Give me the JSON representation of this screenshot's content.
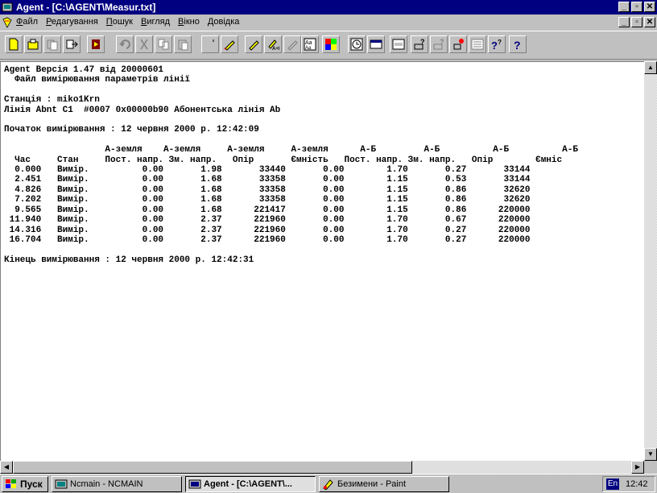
{
  "window": {
    "title": "Agent - [C:\\AGENT\\Measur.txt]",
    "controls": [
      "_",
      "▫",
      "✕"
    ]
  },
  "menu": {
    "items": [
      {
        "accel": "Ф",
        "rest": "айл"
      },
      {
        "accel": "Р",
        "rest": "едагування"
      },
      {
        "accel": "П",
        "rest": "ошук"
      },
      {
        "accel": "В",
        "rest": "игляд"
      },
      {
        "accel": "В",
        "rest": "ікно"
      },
      {
        "accel": "Д",
        "rest": "овідка"
      }
    ],
    "doc_controls": [
      "_",
      "▫",
      "✕"
    ]
  },
  "toolbar": {
    "icons": [
      "new-file-icon",
      "open-file-icon",
      "copy-file-icon",
      "export-file-icon",
      "exit-icon",
      "undo-icon",
      "cut-icon",
      "copy-icon",
      "paste-icon",
      "clear-icon",
      "edit-icon",
      "find-icon",
      "replace-icon",
      "find-next-icon",
      "font-icon",
      "colors-icon",
      "clock-icon",
      "window-icon",
      "status-icon",
      "help-topic-icon",
      "help-context-icon",
      "help-search-icon",
      "help-index-icon",
      "about-icon",
      "help-icon"
    ]
  },
  "document": {
    "text": "Agent Версія 1.47 від 20000601\n  Файл вимірювання параметрів лінії\n\nСтанція : miko1Krn\nЛінія Abnt C1  #0007 0x00000b90 Абонентська лінія Ab\n\nПочаток вимірювання : 12 червня 2000 р. 12:42:09\n\n                   А-земля    А-земля     А-земля     А-земля      А-Б         А-Б          А-Б          А-Б\n  Час     Стан     Пост. напр. Зм. напр.   Опір       Ємність   Пост. напр. Зм. напр.   Опір        Ємніс\n  0.000   Вимір.          0.00       1.98       33440       0.00        1.70       0.27       33144\n  2.451   Вимір.          0.00       1.68       33358       0.00        1.15       0.53       33144\n  4.826   Вимір.          0.00       1.68       33358       0.00        1.15       0.86       32620\n  7.202   Вимір.          0.00       1.68       33358       0.00        1.15       0.86       32620\n  9.565   Вимір.          0.00       1.68      221417       0.00        1.15       0.86      220000\n 11.940   Вимір.          0.00       2.37      221960       0.00        1.70       0.67      220000\n 14.316   Вимір.          0.00       2.37      221960       0.00        1.70       0.27      220000\n 16.704   Вимір.          0.00       2.37      221960       0.00        1.70       0.27      220000\n\nКінець вимірювання : 12 червня 2000 р. 12:42:31"
  },
  "taskbar": {
    "start_label": "Пуск",
    "tasks": [
      {
        "label": "Ncmain - NCMAIN"
      },
      {
        "label": "Agent - [C:\\AGENT\\..."
      },
      {
        "label": "Безимени - Paint"
      }
    ],
    "lang": "En",
    "clock": "12:42"
  }
}
